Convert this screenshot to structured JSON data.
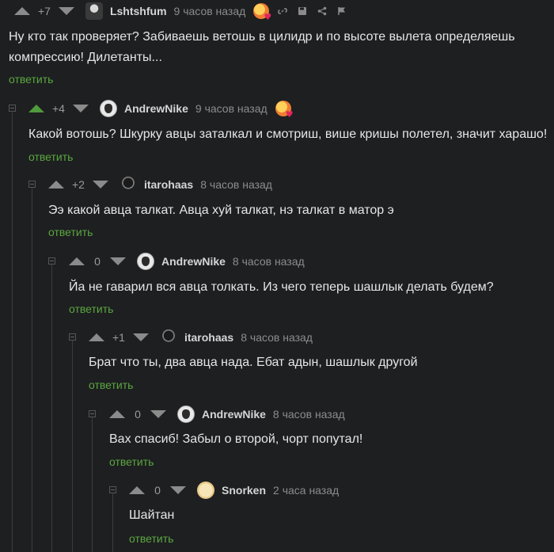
{
  "reply_label": "ответить",
  "comments": [
    {
      "rating": "+7",
      "author": "Lshtshfum",
      "time": "9 часов назад",
      "text": "Ну кто так проверяет? Забиваешь ветошь в цилидр и по высоте вылета определяешь компрессию! Дилетанты...",
      "avatar": "avatar-lshtshfum",
      "upvoted": false,
      "has_badge": true
    },
    {
      "rating": "+4",
      "author": "AndrewNike",
      "time": "9 часов назад",
      "text": "Какой вотошь? Шкурку авцы заталкал и смотриш, више кришы полетел, значит харашо!",
      "avatar": "avatar-andrewnike",
      "upvoted": true,
      "has_badge": true
    },
    {
      "rating": "+2",
      "author": "itarohaas",
      "time": "8 часов назад",
      "text": "Ээ какой авца талкат. Авца хуй талкат, нэ талкат в матор э",
      "avatar": "avatar-itarohaas",
      "upvoted": false,
      "has_badge": false
    },
    {
      "rating": "0",
      "author": "AndrewNike",
      "time": "8 часов назад",
      "text": "Йа не гаварил вся авца толкать. Из чего теперь шашлык делать будем?",
      "avatar": "avatar-andrewnike",
      "upvoted": false,
      "has_badge": false
    },
    {
      "rating": "+1",
      "author": "itarohaas",
      "time": "8 часов назад",
      "text": "Брат что ты, два авца нада. Ебат адын, шашлык другой",
      "avatar": "avatar-itarohaas",
      "upvoted": false,
      "has_badge": false
    },
    {
      "rating": "0",
      "author": "AndrewNike",
      "time": "8 часов назад",
      "text": "Вах спасиб! Забыл о второй, чорт попутал!",
      "avatar": "avatar-andrewnike",
      "upvoted": false,
      "has_badge": false
    },
    {
      "rating": "0",
      "author": "Snorken",
      "time": "2 часа назад",
      "text": "Шайтан",
      "avatar": "avatar-snorken",
      "upvoted": false,
      "has_badge": false
    }
  ],
  "colors": {
    "background": "#1e1f21",
    "reply_link": "#5aa73f",
    "upvote_active": "#4e9a3d",
    "muted": "#8c8c8c"
  },
  "icons": {
    "first_comment_actions": [
      "link-icon",
      "save-icon",
      "share-icon",
      "flag-icon"
    ]
  }
}
